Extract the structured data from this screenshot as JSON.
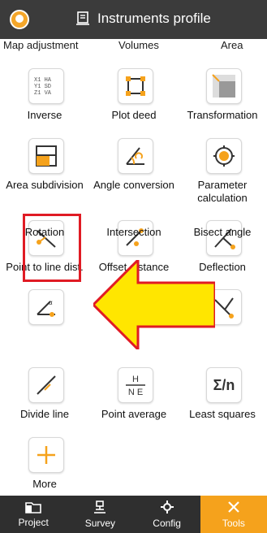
{
  "header": {
    "title": "Instruments profile"
  },
  "top_partial": [
    "Map adjustment",
    "Volumes",
    "Area"
  ],
  "tools": [
    {
      "label": "Inverse",
      "icon": "inverse-icon"
    },
    {
      "label": "Plot deed",
      "icon": "plot-deed-icon"
    },
    {
      "label": "Transformation",
      "icon": "transformation-icon"
    },
    {
      "label": "Area subdivision",
      "icon": "area-subdivision-icon"
    },
    {
      "label": "Angle conversion",
      "icon": "angle-conversion-icon"
    },
    {
      "label": "Parameter calculation",
      "icon": "parameter-calculation-icon"
    },
    {
      "label": "Point to line dist.",
      "icon": "point-to-line-icon"
    },
    {
      "label": "Offset distance",
      "icon": "offset-distance-icon"
    },
    {
      "label": "Deflection",
      "icon": "deflection-icon"
    },
    {
      "label": "Rotation",
      "icon": "rotation-icon"
    },
    {
      "label": "Intersection",
      "icon": "intersection-icon"
    },
    {
      "label": "Bisect angle",
      "icon": "bisect-angle-icon"
    },
    {
      "label": "Divide line",
      "icon": "divide-line-icon"
    },
    {
      "label": "Point average",
      "icon": "point-average-icon"
    },
    {
      "label": "Least squares",
      "icon": "least-squares-icon"
    },
    {
      "label": "More",
      "icon": "plus-icon"
    }
  ],
  "inverse_icon_text": [
    "X1 HA",
    "Y1 SD",
    "Z1 VA"
  ],
  "point_average_icon_text": [
    "H",
    "N E"
  ],
  "least_squares_icon_text": "Σ/n",
  "footer": [
    {
      "label": "Project",
      "icon": "folder-icon"
    },
    {
      "label": "Survey",
      "icon": "survey-icon"
    },
    {
      "label": "Config",
      "icon": "gear-icon"
    },
    {
      "label": "Tools",
      "icon": "tools-icon",
      "active": true
    }
  ],
  "colors": {
    "accent": "#f5a21c",
    "header": "#3b3b3b",
    "footer": "#2f2f2f",
    "highlight": "#e01b24",
    "arrow": "#ffe600"
  }
}
